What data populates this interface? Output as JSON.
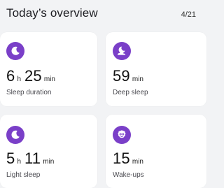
{
  "header": {
    "title": "Today’s overview",
    "date": "4/21"
  },
  "colors": {
    "accent": "#7a3fc8",
    "card_bg": "#ffffff",
    "page_bg": "#f2f3f5"
  },
  "cards": [
    {
      "icon": "moon-icon",
      "value_parts": [
        {
          "num": "6",
          "unit": "h"
        },
        {
          "num": "25",
          "unit": "min"
        }
      ],
      "label": "Sleep duration"
    },
    {
      "icon": "moon-cloud-icon",
      "value_parts": [
        {
          "num": "59",
          "unit": "min"
        }
      ],
      "label": "Deep sleep"
    },
    {
      "icon": "moon-icon",
      "value_parts": [
        {
          "num": "5",
          "unit": "h"
        },
        {
          "num": "11",
          "unit": "min"
        }
      ],
      "label": "Light sleep"
    },
    {
      "icon": "wake-up-face-icon",
      "value_parts": [
        {
          "num": "15",
          "unit": "min"
        }
      ],
      "label": "Wake-ups"
    }
  ]
}
